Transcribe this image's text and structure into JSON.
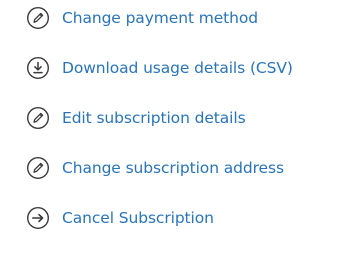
{
  "actions": [
    {
      "icon": "pencil-circle-icon",
      "label": "Change payment method"
    },
    {
      "icon": "download-circle-icon",
      "label": "Download usage details (CSV)"
    },
    {
      "icon": "pencil-circle-icon",
      "label": "Edit subscription details"
    },
    {
      "icon": "pencil-circle-icon",
      "label": "Change subscription address"
    },
    {
      "icon": "arrow-right-circle-icon",
      "label": "Cancel Subscription"
    }
  ],
  "colors": {
    "link": "#2a74b8",
    "icon": "#3a3a3a"
  }
}
